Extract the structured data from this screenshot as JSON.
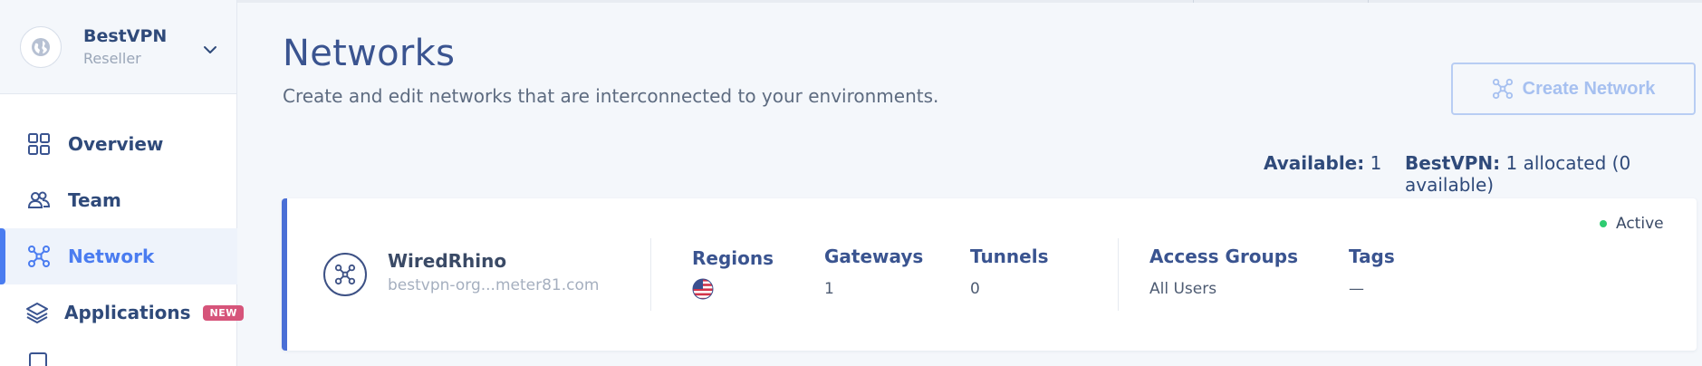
{
  "org": {
    "name": "BestVPN",
    "role": "Reseller"
  },
  "sidebar": {
    "items": [
      {
        "label": "Overview",
        "icon": "grid-icon"
      },
      {
        "label": "Team",
        "icon": "users-icon"
      },
      {
        "label": "Network",
        "icon": "network-icon",
        "active": true
      },
      {
        "label": "Applications",
        "icon": "layers-icon",
        "badge": "NEW"
      },
      {
        "label": "",
        "icon": "partial-icon"
      }
    ]
  },
  "header": {
    "title": "Networks",
    "subtitle": "Create and edit networks that are interconnected to your environments.",
    "create_label": "Create Network"
  },
  "availability": {
    "available_label": "Available:",
    "available_value": "1",
    "org_label": "BestVPN:",
    "org_value": "1 allocated (0 available)"
  },
  "network": {
    "name": "WiredRhino",
    "domain": "bestvpn-org...meter81.com",
    "status": "Active",
    "columns": {
      "regions": "Regions",
      "gateways": "Gateways",
      "tunnels": "Tunnels",
      "access_groups": "Access Groups",
      "tags": "Tags"
    },
    "values": {
      "gateways": "1",
      "tunnels": "0",
      "access_groups": "All Users",
      "tags": "—"
    }
  },
  "colors": {
    "accent": "#4a7cf0",
    "status_active": "#2ecc71",
    "badge_new": "#d6547a"
  }
}
